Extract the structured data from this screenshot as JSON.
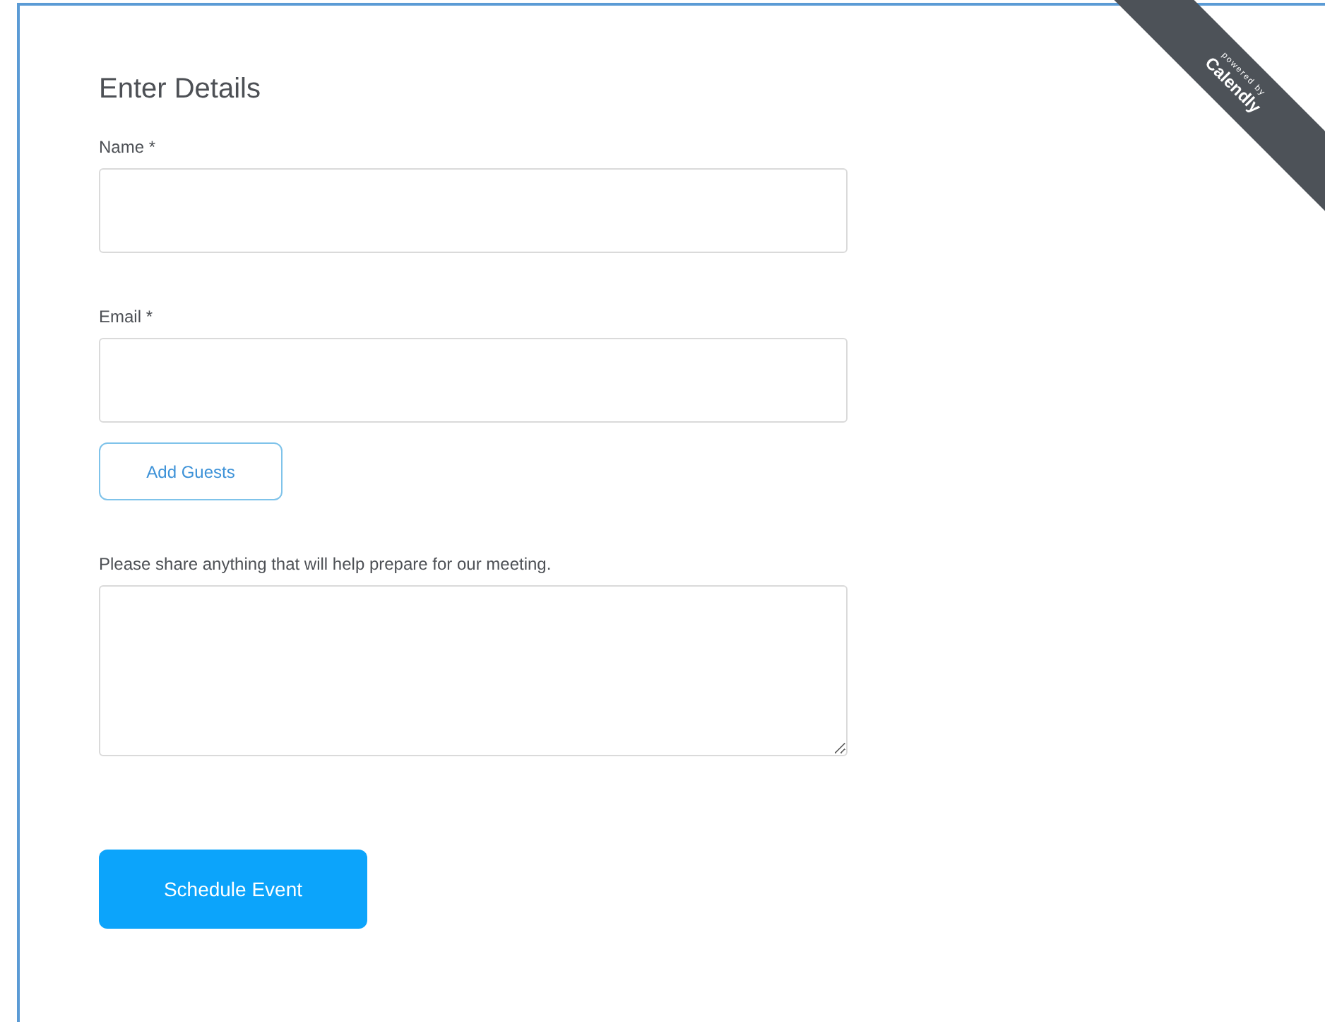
{
  "ribbon": {
    "caption": "powered by",
    "brand": "Calendly"
  },
  "heading": "Enter Details",
  "fields": [
    {
      "label": "Name *",
      "kind": "input"
    },
    {
      "label": "Email *",
      "kind": "input"
    },
    {
      "label": "Please share anything that will help prepare for our meeting.",
      "kind": "textarea"
    }
  ],
  "add_guests": "Add Guests",
  "submit": "Schedule Event"
}
